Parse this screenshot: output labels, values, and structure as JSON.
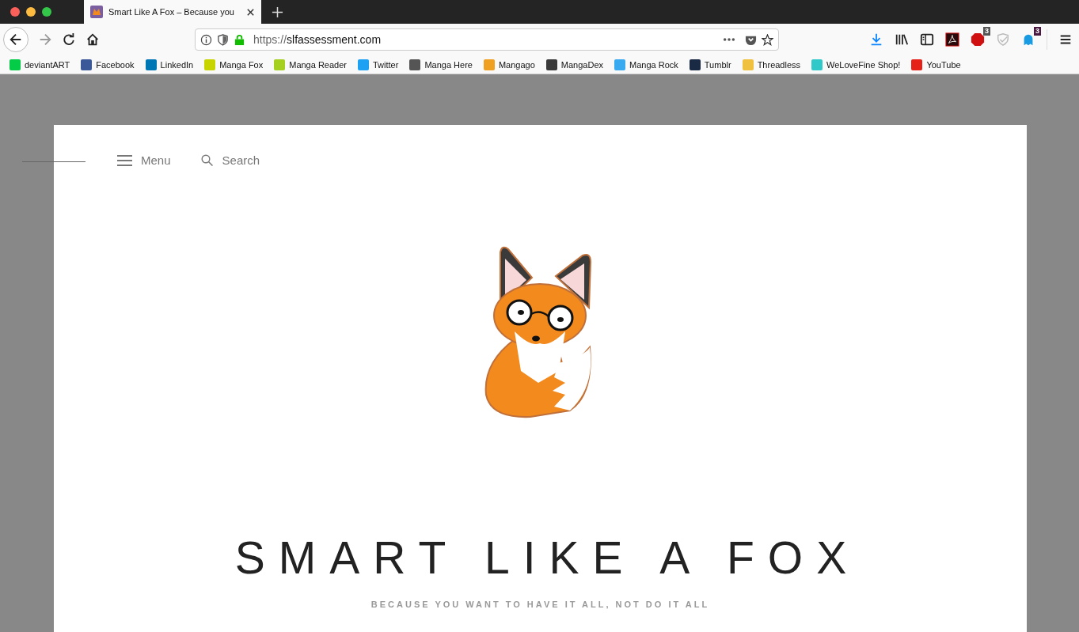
{
  "tab": {
    "title": "Smart Like A Fox – Because you",
    "selected": true
  },
  "address": {
    "url_scheme": "https://",
    "url_host": "slfassessment.com"
  },
  "extension_badges": [
    {
      "count": "3",
      "color": "#555555"
    },
    {
      "count": "3",
      "color": "#4a1942"
    }
  ],
  "bookmarks": [
    {
      "label": "deviantART",
      "color": "#05cc47"
    },
    {
      "label": "Facebook",
      "color": "#3b5998"
    },
    {
      "label": "LinkedIn",
      "color": "#0077b5"
    },
    {
      "label": "Manga Fox",
      "color": "#c8d400"
    },
    {
      "label": "Manga Reader",
      "color": "#a5d020"
    },
    {
      "label": "Twitter",
      "color": "#1da1f2"
    },
    {
      "label": "Manga Here",
      "color": "#555555"
    },
    {
      "label": "Mangago",
      "color": "#f0a020"
    },
    {
      "label": "MangaDex",
      "color": "#3a3a3a"
    },
    {
      "label": "Manga Rock",
      "color": "#3aaaf0"
    },
    {
      "label": "Tumblr",
      "color": "#1a2a44"
    },
    {
      "label": "Threadless",
      "color": "#f0c040"
    },
    {
      "label": "WeLoveFine Shop!",
      "color": "#30c8c8"
    },
    {
      "label": "YouTube",
      "color": "#e62117"
    }
  ],
  "site": {
    "menu_label": "Menu",
    "search_label": "Search",
    "title": "SMART LIKE A FOX",
    "tagline": "BECAUSE YOU WANT TO HAVE IT ALL, NOT DO IT ALL"
  }
}
